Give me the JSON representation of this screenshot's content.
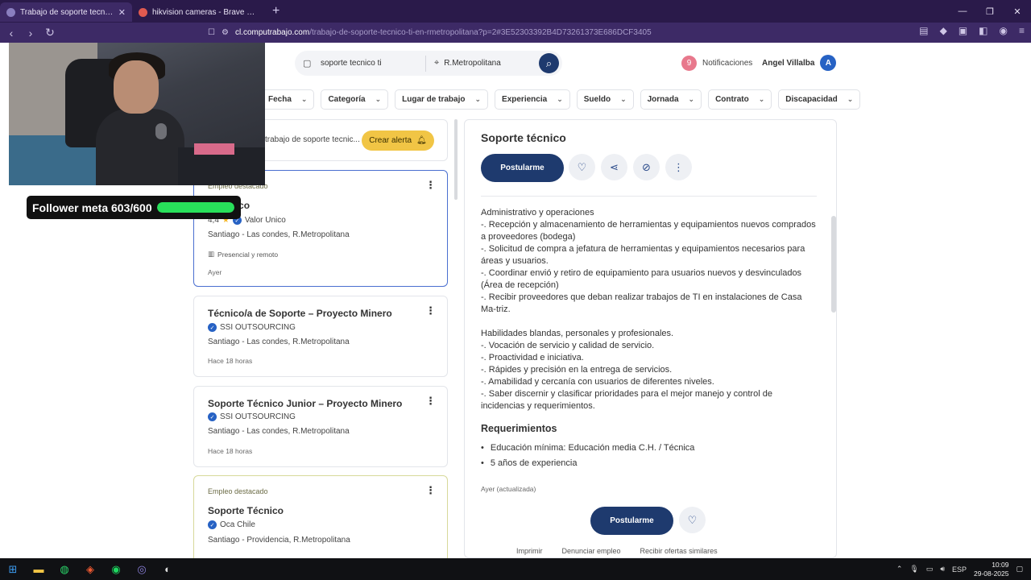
{
  "browser": {
    "tabs": [
      {
        "title": "Trabajo de soporte tecnico ti en",
        "active": true
      },
      {
        "title": "hikvision cameras - Brave Search",
        "active": false
      }
    ],
    "url_host": "cl.computrabajo.com",
    "url_path": "/trabajo-de-soporte-tecnico-ti-en-rmetropolitana?p=2#3E52303392B4D73261373E686DCF3405"
  },
  "overlay": {
    "follower_text": "Follower meta 603/600",
    "follower_progress": 1.0
  },
  "header": {
    "search_value": "soporte tecnico ti",
    "location_value": "R.Metropolitana",
    "notifications_count": "9",
    "notifications_label": "Notificaciones",
    "user_name": "Angel Villalba",
    "avatar_initial": "A"
  },
  "filters": [
    "Fecha",
    "Categoría",
    "Lugar de trabajo",
    "Experiencia",
    "Sueldo",
    "Jornada",
    "Contrato",
    "Discapacidad"
  ],
  "alert": {
    "text": "trabajo de soporte tecnic...",
    "button": "Crear alerta"
  },
  "cards": [
    {
      "featured_label": "Empleo destacado",
      "title": "e técnico",
      "rating": "4,4",
      "company": "Valor Unico",
      "location": "Santiago - Las condes, R.Metropolitana",
      "modality": "Presencial y remoto",
      "date": "Ayer"
    },
    {
      "title": "Técnico/a de Soporte – Proyecto Minero",
      "company": "SSI OUTSOURCING",
      "location": "Santiago - Las condes, R.Metropolitana",
      "date": "Hace 18 horas"
    },
    {
      "title": "Soporte Técnico Junior – Proyecto Minero",
      "company": "SSI OUTSOURCING",
      "location": "Santiago - Las condes, R.Metropolitana",
      "date": "Hace 18 horas"
    },
    {
      "featured_label": "Empleo destacado",
      "title": "Soporte Técnico",
      "company": "Oca Chile",
      "location": "Santiago - Providencia, R.Metropolitana"
    }
  ],
  "detail": {
    "title": "Soporte técnico",
    "apply_label": "Postularme",
    "description_1": "Administrativo y operaciones\n-. Recepción y almacenamiento de herramientas y equipamientos nuevos comprados a proveedores (bodega)\n-. Solicitud de compra a jefatura de herramientas y equipamientos necesarios para áreas y usuarios.\n-. Coordinar envió y retiro de equipamiento para usuarios nuevos y desvinculados (Área de recepción)\n-. Recibir proveedores que deban realizar trabajos de TI en instalaciones de Casa Ma-triz.",
    "description_2": "Habilidades blandas, personales y profesionales.\n-. Vocación de servicio y calidad de servicio.\n-. Proactividad e iniciativa.\n-. Rápides y precisión en la entrega de servicios.\n-. Amabilidad y cercanía con usuarios de diferentes niveles.\n-. Saber discernir y clasificar prioridades para el mejor manejo y control de incidencias y requerimientos.",
    "requirements_title": "Requerimientos",
    "requirements": [
      "Educación mínima: Educación media C.H. / Técnica",
      "5 años de experiencia"
    ],
    "updated": "Ayer (actualizada)",
    "footer_links": [
      "Imprimir",
      "Denunciar empleo",
      "Recibir ofertas similares"
    ]
  },
  "taskbar": {
    "lang": "ESP",
    "time": "10:09",
    "date": "29-08-2025"
  }
}
